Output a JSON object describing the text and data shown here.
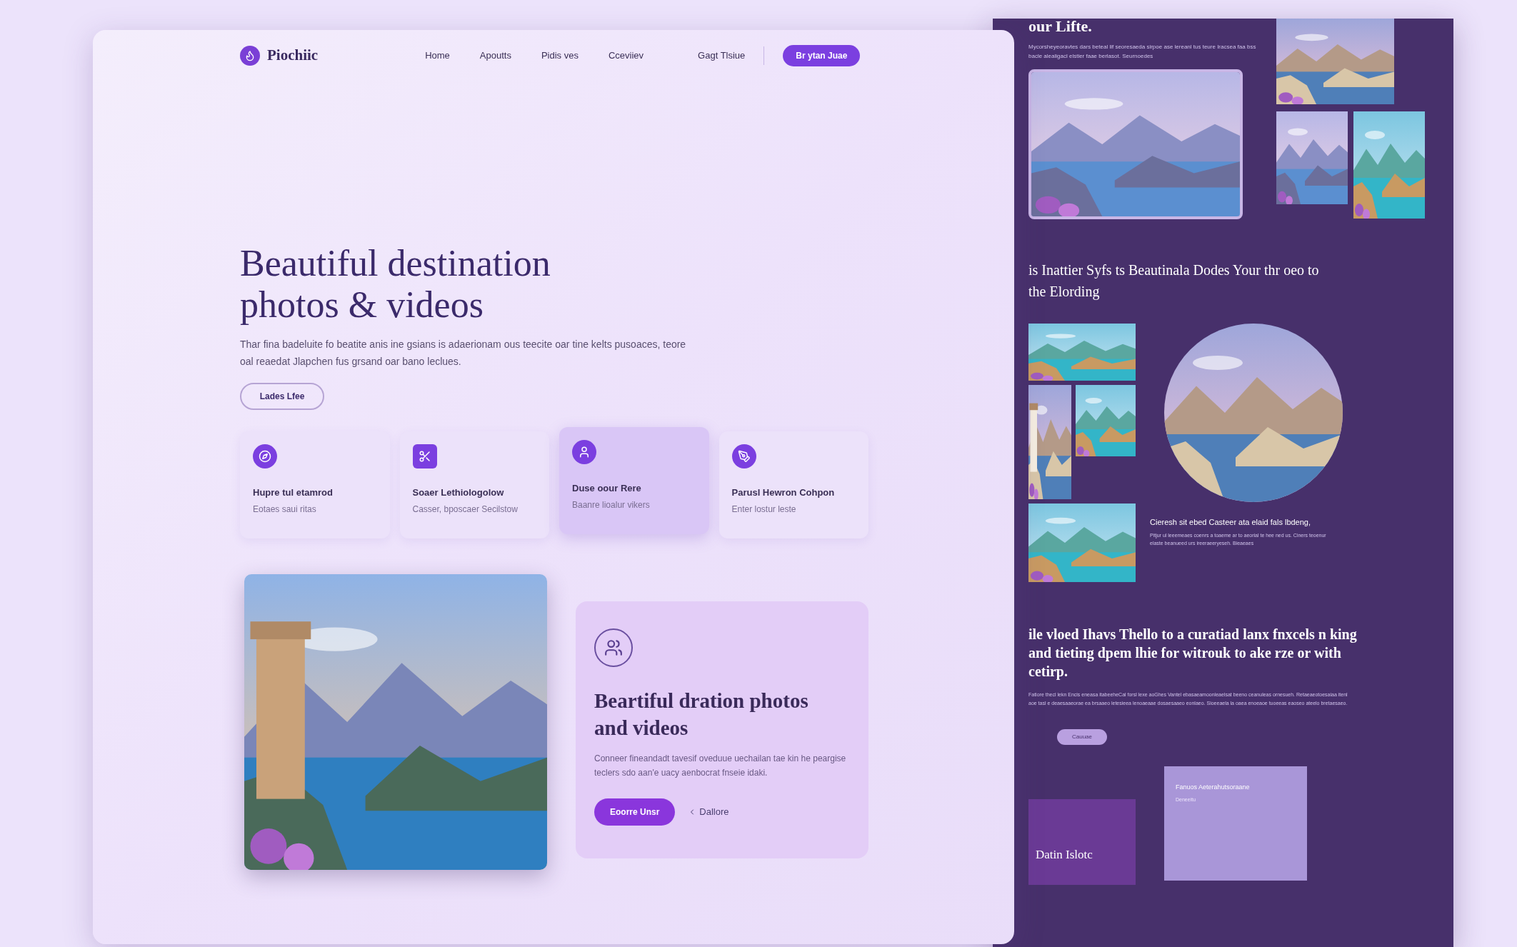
{
  "front_page": {
    "brand": "Piochiic",
    "nav_links": [
      "Home",
      "Apoutts",
      "Pidis ves",
      "Cceviiev"
    ],
    "sign_in": "Gagt Tlsiue",
    "cta": "Br ytan Juae",
    "hero": {
      "title": "Beautiful destination photos & videos",
      "text": "Thar fina badeluite fo beatite anis ine gsians is adaerionam ous teecite oar tine kelts pusoaces, teore oal reaedat Jlapchen fus grsand oar bano leclues.",
      "button": "Lades Lfee"
    },
    "features": [
      {
        "kind": "compass",
        "title": "Hupre tul etamrod",
        "subtitle": "Eotaes saui ritas",
        "selected": false
      },
      {
        "kind": "scissors",
        "title": "Soaer Lethiologolow",
        "subtitle": "Casser, bposcaer Secilstow",
        "selected": false
      },
      {
        "kind": "user",
        "title": "Duse oour Rere",
        "subtitle": "Baanre lioalur vikers",
        "selected": true
      },
      {
        "kind": "pen",
        "title": "Parusl Hewron Cohpon",
        "subtitle": "Enter lostur leste",
        "selected": false
      }
    ],
    "showcase": {
      "title": "Beartiful dration photos and videos",
      "text": "Conneer fineandadt tavesif oveduue uechailan tae kin he peargise teclers sdo aan'e uacy aenbocrat fnseie idaki.",
      "primary_button": "Eoorre Unsr",
      "secondary_link": "Dallore"
    }
  },
  "back_page": {
    "top_heading": "our Lifte.",
    "top_text": "Mycorsheyeoravtes dars beteal lif seoresaeda sirpoe ase lereanl tus teure Iracsea faa bss bacle alealigacl elstier faae berlasot. Seurnoedes",
    "section_heading": "is Inattier Syfs ts Beautinala Dodes Your thr oeo to the Elording",
    "caption_title": "Cieresh sit ebed Casteer ata elaid fals lbdeng,",
    "caption_text": "Pitjur ul leeemeaes coenrs a toaeme ar to aeorial te hee ned us. Ciners teoenur elaste beanueed urs ireeraeeryeseh. Bieaeaes",
    "feature_heading": "ile vloed Ihavs Thello to a curatiad lanx fnxcels n king and tieting dpem lhie for witrouk to ake rze or with cetirp.",
    "feature_text": "Fatiore thecl lekn Encis eneasa itabeeheCal forsl lexe aoGhes Vantel ebasaeamoonleaelsat beeno ceanuleas ornesueh. Retaeaeotoesaiaa itenl aoe tasl e deaesaaeorae ea brsaaeo letesieea lenoaeaae dosaesaaeo eonlaeo. Sioeeaela la oaea enoeaoe tuoeeas eaoseo ateelo bretaesaeo.",
    "pill_button": "Cauuae",
    "promo_title": "Datin Islotc",
    "card_title": "Fanuos Aeterahutsoraane",
    "card_text": "Deneeitu"
  }
}
